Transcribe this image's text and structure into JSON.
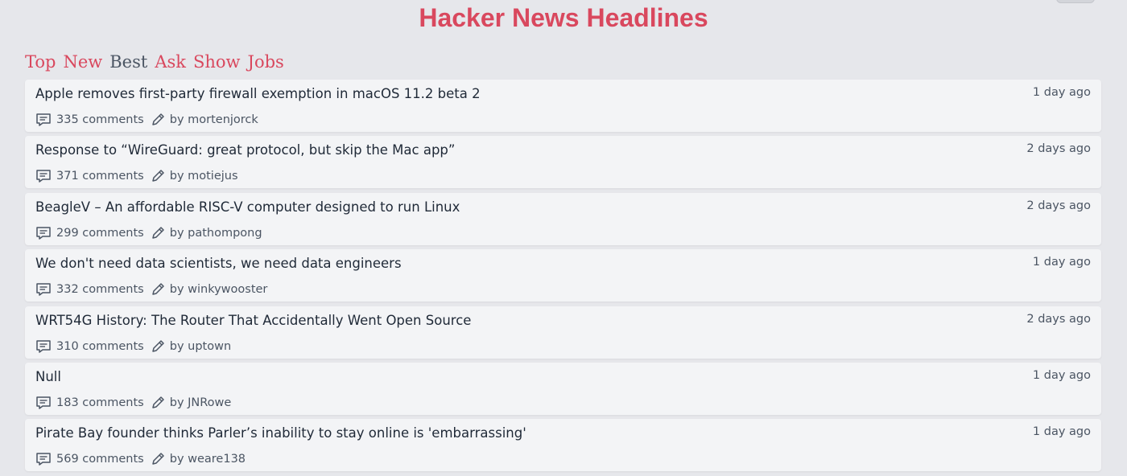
{
  "header": {
    "title": "Hacker News Headlines"
  },
  "nav": {
    "items": [
      {
        "label": "Top",
        "active": false
      },
      {
        "label": "New",
        "active": false
      },
      {
        "label": "Best",
        "active": true
      },
      {
        "label": "Ask",
        "active": false
      },
      {
        "label": "Show",
        "active": false
      },
      {
        "label": "Jobs",
        "active": false
      }
    ]
  },
  "colors": {
    "accent": "#d9485e",
    "active_nav": "#4b5563",
    "background": "#e6e7eb",
    "card": "#f3f4f6"
  },
  "icons": {
    "comments": "comment-bubble-icon",
    "author": "pencil-icon"
  },
  "stories": [
    {
      "title": "Apple removes first-party firewall exemption in macOS 11.2 beta 2",
      "time": "1 day ago",
      "comments": "335 comments",
      "author": "by mortenjorck"
    },
    {
      "title": "Response to “WireGuard: great protocol, but skip the Mac app”",
      "time": "2 days ago",
      "comments": "371 comments",
      "author": "by motiejus"
    },
    {
      "title": "BeagleV – An affordable RISC-V computer designed to run Linux",
      "time": "2 days ago",
      "comments": "299 comments",
      "author": "by pathompong"
    },
    {
      "title": "We don't need data scientists, we need data engineers",
      "time": "1 day ago",
      "comments": "332 comments",
      "author": "by winkywooster"
    },
    {
      "title": "WRT54G History: The Router That Accidentally Went Open Source",
      "time": "2 days ago",
      "comments": "310 comments",
      "author": "by uptown"
    },
    {
      "title": "Null",
      "time": "1 day ago",
      "comments": "183 comments",
      "author": "by JNRowe"
    },
    {
      "title": "Pirate Bay founder thinks Parler’s inability to stay online is 'embarrassing'",
      "time": "1 day ago",
      "comments": "569 comments",
      "author": "by weare138"
    }
  ]
}
